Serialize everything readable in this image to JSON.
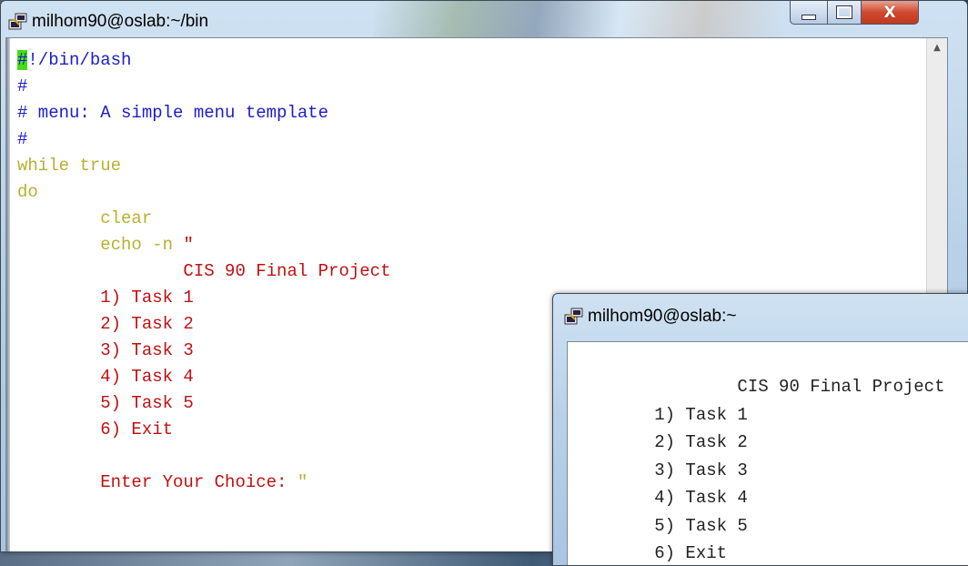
{
  "main_window": {
    "title": "milhom90@oslab:~/bin",
    "icon": "putty-icon",
    "controls": {
      "minimize": "minimize-icon",
      "maximize": "maximize-icon",
      "close_glyph": "X"
    },
    "lines": [
      [
        {
          "t": "#",
          "c": "cursor"
        },
        {
          "t": "!/bin/bash",
          "c": "blue"
        }
      ],
      [
        {
          "t": "#",
          "c": "blue"
        }
      ],
      [
        {
          "t": "# menu: A simple menu template",
          "c": "blue"
        }
      ],
      [
        {
          "t": "#",
          "c": "blue"
        }
      ],
      [
        {
          "t": "while true",
          "c": "olive"
        }
      ],
      [
        {
          "t": "do",
          "c": "olive"
        }
      ],
      [
        {
          "t": "        clear",
          "c": "olive"
        }
      ],
      [
        {
          "t": "        echo -n ",
          "c": "olive"
        },
        {
          "t": "\"",
          "c": "red"
        }
      ],
      [
        {
          "t": "                CIS 90 Final Project",
          "c": "red"
        }
      ],
      [
        {
          "t": "        1) Task 1",
          "c": "red"
        }
      ],
      [
        {
          "t": "        2) Task 2",
          "c": "red"
        }
      ],
      [
        {
          "t": "        3) Task 3",
          "c": "red"
        }
      ],
      [
        {
          "t": "        4) Task 4",
          "c": "red"
        }
      ],
      [
        {
          "t": "        5) Task 5",
          "c": "red"
        }
      ],
      [
        {
          "t": "        6) Exit",
          "c": "red"
        }
      ],
      [
        {
          "t": "",
          "c": "red"
        }
      ],
      [
        {
          "t": "        Enter Your Choice: ",
          "c": "red"
        },
        {
          "t": "\"",
          "c": "olive"
        }
      ]
    ]
  },
  "second_window": {
    "title": "milhom90@oslab:~",
    "icon": "putty-icon",
    "lines": [
      "                CIS 90 Final Project",
      "        1) Task 1",
      "        2) Task 2",
      "        3) Task 3",
      "        4) Task 4",
      "        5) Task 5",
      "        6) Exit"
    ]
  },
  "scrollbar": {
    "up_arrow": "▲"
  }
}
